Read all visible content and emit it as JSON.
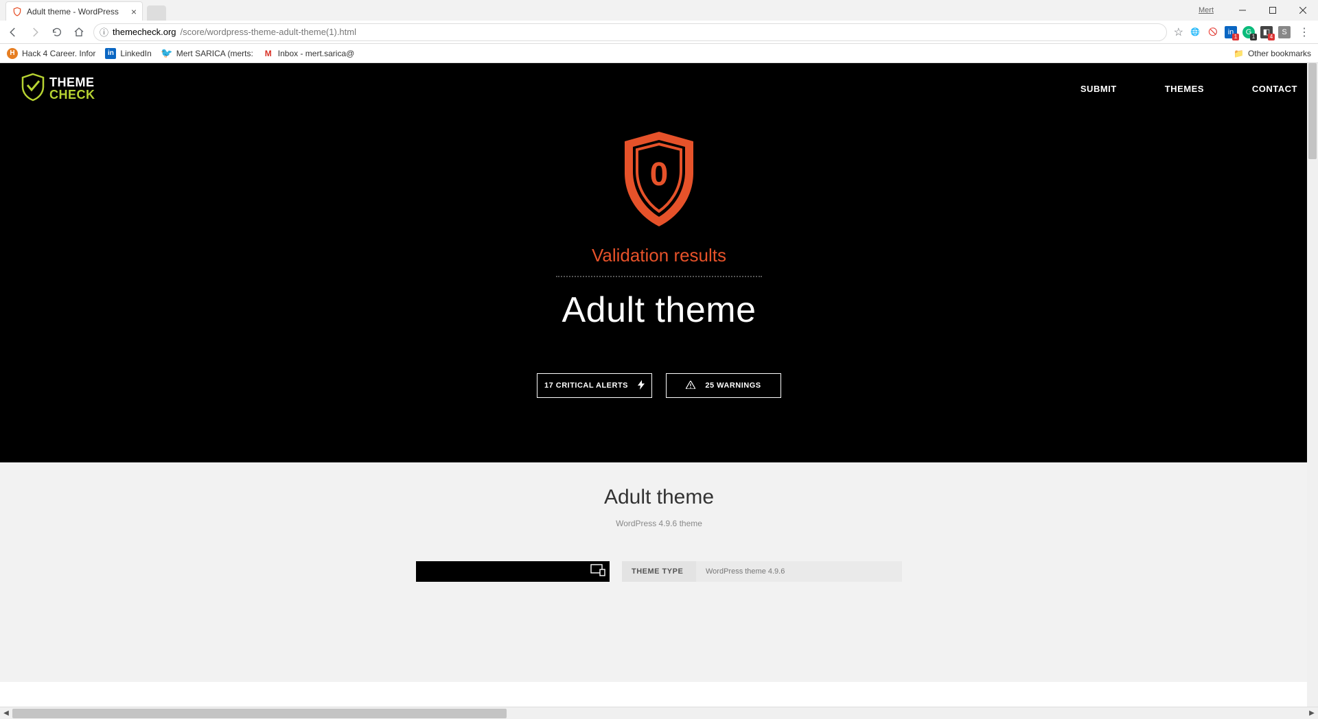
{
  "browser": {
    "tab_title": "Adult theme - WordPress",
    "user_label": "Mert",
    "url_host": "themecheck.org",
    "url_path": "/score/wordpress-theme-adult-theme(1).html",
    "bookmarks": [
      {
        "label": "Hack 4 Career. Infor"
      },
      {
        "label": "LinkedIn"
      },
      {
        "label": "Mert SARICA (merts:"
      },
      {
        "label": "Inbox - mert.sarica@"
      }
    ],
    "other_bookmarks": "Other bookmarks"
  },
  "site": {
    "logo_line1": "THEME",
    "logo_line2": "CHECK",
    "nav": [
      "SUBMIT",
      "THEMES",
      "CONTACT"
    ]
  },
  "hero": {
    "score": "0",
    "label": "Validation results",
    "theme_name": "Adult theme",
    "critical_alerts": "17 CRITICAL ALERTS",
    "warnings": "25 WARNINGS"
  },
  "details": {
    "heading": "Adult theme",
    "subtitle": "WordPress 4.9.6 theme",
    "type_key": "THEME TYPE",
    "type_value": "WordPress theme 4.9.6"
  }
}
